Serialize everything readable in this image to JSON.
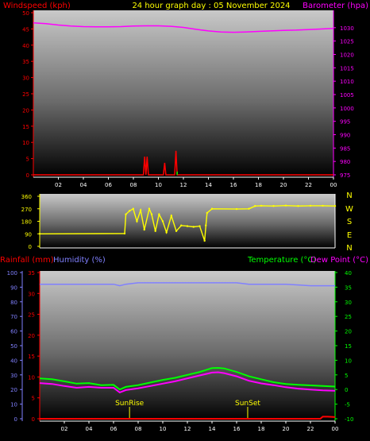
{
  "top_header": {
    "windspeed_label": "Windspeed (kph)",
    "title": "24 hour graph day : 05 November 2024",
    "barometer_label": "Barometer (hpa)"
  },
  "colors": {
    "windspeed": "#ff0000",
    "barometer": "#ff00ff",
    "title": "#ffff00",
    "direction": "#ffff00",
    "rain": "#ff0000",
    "humidity": "#8080ff",
    "temperature": "#00ff00",
    "dewpoint": "#ff00ff",
    "compass": "#ffff00",
    "sun": "#ffff00"
  },
  "bottom_header": {
    "rainfall_label": "Rainfall (mm)",
    "humidity_label": "Humidity (%)",
    "temperature_label": "Temperature (°C)",
    "dewpoint_label": "Dew Point (°C)"
  },
  "compass": [
    "N",
    "W",
    "S",
    "E",
    "N"
  ],
  "sun": {
    "sunrise_label": "SunRise",
    "sunset_label": "SunSet",
    "sunrise_hour": 7.3,
    "sunset_hour": 16.9
  },
  "chart_data": [
    {
      "type": "line",
      "xlabel": "",
      "x_ticks": [
        "02",
        "04",
        "06",
        "08",
        "10",
        "12",
        "14",
        "16",
        "18",
        "20",
        "22",
        "00"
      ],
      "x_range_hours": [
        0,
        24
      ],
      "y_left": {
        "label": "Windspeed (kph)",
        "range": [
          0,
          50
        ],
        "ticks": [
          0,
          5,
          10,
          15,
          20,
          25,
          30,
          35,
          40,
          45,
          50
        ]
      },
      "y_right": {
        "label": "Barometer (hpa)",
        "range": [
          975,
          1035
        ],
        "ticks": [
          975,
          980,
          985,
          990,
          995,
          1000,
          1005,
          1010,
          1015,
          1020,
          1025,
          1030
        ]
      },
      "series": [
        {
          "name": "Barometer (hpa)",
          "axis": "right",
          "x": [
            0,
            1,
            2,
            3,
            4,
            5,
            6,
            7,
            8,
            9,
            10,
            11,
            12,
            13,
            14,
            15,
            16,
            17,
            18,
            19,
            20,
            21,
            22,
            23,
            24
          ],
          "y": [
            1031.8,
            1031.5,
            1031,
            1030.6,
            1030.4,
            1030.3,
            1030.3,
            1030.4,
            1030.6,
            1030.7,
            1030.7,
            1030.5,
            1030.1,
            1029.4,
            1028.8,
            1028.4,
            1028.3,
            1028.4,
            1028.6,
            1028.8,
            1029,
            1029.1,
            1029.3,
            1029.5,
            1029.7
          ]
        },
        {
          "name": "Windspeed (kph)",
          "axis": "left",
          "x": [
            0,
            8.8,
            8.9,
            9.0,
            9.1,
            9.2,
            10.4,
            10.5,
            10.6,
            11.3,
            11.4,
            11.5,
            11.6,
            24
          ],
          "y": [
            0,
            0,
            5.6,
            0,
            5.6,
            0,
            0,
            3.7,
            0,
            0,
            7.4,
            0,
            0,
            0
          ]
        }
      ]
    },
    {
      "type": "scatter",
      "x_ticks": [
        "02",
        "04",
        "06",
        "08",
        "10",
        "12",
        "14",
        "16",
        "18",
        "20",
        "22",
        "00"
      ],
      "x_range_hours": [
        0,
        24
      ],
      "y_left": {
        "label": "",
        "range": [
          0,
          360
        ],
        "ticks": [
          0,
          90,
          180,
          270,
          360
        ]
      },
      "y_right_labels": [
        "N",
        "W",
        "S",
        "E",
        "N"
      ],
      "series": [
        {
          "name": "Wind direction",
          "x": [
            0,
            6.9,
            7.0,
            7.3,
            7.6,
            7.9,
            8.2,
            8.5,
            8.9,
            9.1,
            9.4,
            9.7,
            10.0,
            10.3,
            10.7,
            11.1,
            11.5,
            12.0,
            12.5,
            13.0,
            13.4,
            13.5,
            13.6,
            14.0,
            16.0,
            17.0,
            17.5,
            18.0,
            19.0,
            20.0,
            21.0,
            22.0,
            23.0,
            24.0
          ],
          "y": [
            90,
            92,
            230,
            255,
            270,
            180,
            260,
            120,
            270,
            230,
            110,
            230,
            180,
            100,
            220,
            110,
            150,
            145,
            140,
            145,
            40,
            150,
            240,
            270,
            268,
            270,
            290,
            292,
            290,
            293,
            290,
            292,
            292,
            290
          ]
        }
      ]
    },
    {
      "type": "line",
      "x_ticks": [
        "02",
        "04",
        "06",
        "08",
        "10",
        "12",
        "14",
        "16",
        "18",
        "20",
        "22",
        "00"
      ],
      "x_range_hours": [
        0,
        24
      ],
      "y_far_left": {
        "label": "Humidity (%)",
        "range": [
          0,
          100
        ],
        "ticks": [
          0,
          10,
          20,
          30,
          40,
          50,
          60,
          70,
          80,
          90,
          100
        ]
      },
      "y_left": {
        "label": "Rainfall (mm)",
        "range": [
          0,
          35
        ],
        "ticks": [
          0,
          5,
          10,
          15,
          20,
          25,
          30,
          35
        ]
      },
      "y_right": {
        "label": "Temperature (°C)",
        "range": [
          -10,
          40
        ],
        "ticks": [
          -10,
          -5,
          0,
          5,
          10,
          15,
          20,
          25,
          30,
          35,
          40
        ]
      },
      "series": [
        {
          "name": "Humidity (%)",
          "axis": "far_left",
          "x": [
            0,
            4,
            6,
            6.5,
            7,
            8,
            10,
            12,
            14,
            16,
            17,
            18,
            20,
            22,
            24
          ],
          "y": [
            92,
            92,
            92,
            91,
            92,
            93,
            93,
            93,
            93,
            93,
            92,
            92,
            92,
            91,
            91
          ]
        },
        {
          "name": "Temperature (°C)",
          "axis": "right",
          "x": [
            0,
            1,
            2,
            3,
            4,
            5,
            6,
            6.5,
            7,
            8,
            9,
            10,
            11,
            12,
            13,
            14,
            14.5,
            15,
            16,
            17,
            18,
            19,
            20,
            21,
            22,
            23,
            24
          ],
          "y": [
            3.8,
            3.5,
            2.8,
            2,
            2.2,
            1.5,
            1.6,
            0,
            0.9,
            1.5,
            2.4,
            3.3,
            4,
            5,
            6,
            7.3,
            7.4,
            7.2,
            6,
            4.5,
            3.5,
            2.5,
            1.9,
            1.6,
            1.4,
            1.2,
            1
          ]
        },
        {
          "name": "Dew Point (°C)",
          "axis": "right",
          "x": [
            0,
            1,
            2,
            3,
            4,
            5,
            6,
            6.5,
            7,
            8,
            9,
            10,
            11,
            12,
            13,
            14,
            14.5,
            15,
            16,
            17,
            18,
            19,
            20,
            21,
            22,
            23,
            24
          ],
          "y": [
            2.2,
            1.9,
            1.2,
            0.6,
            0.9,
            0.6,
            0.6,
            -1,
            -0.2,
            0.4,
            1.2,
            2,
            2.8,
            3.8,
            4.8,
            5.8,
            5.9,
            5.6,
            4.5,
            3,
            2.1,
            1.5,
            0.8,
            0.3,
            0,
            -0.3,
            -0.4
          ]
        },
        {
          "name": "Rainfall (mm)",
          "axis": "left",
          "x": [
            0,
            22.8,
            23,
            23.4,
            24
          ],
          "y": [
            0,
            0,
            0.5,
            0.5,
            0.4
          ]
        }
      ]
    }
  ]
}
